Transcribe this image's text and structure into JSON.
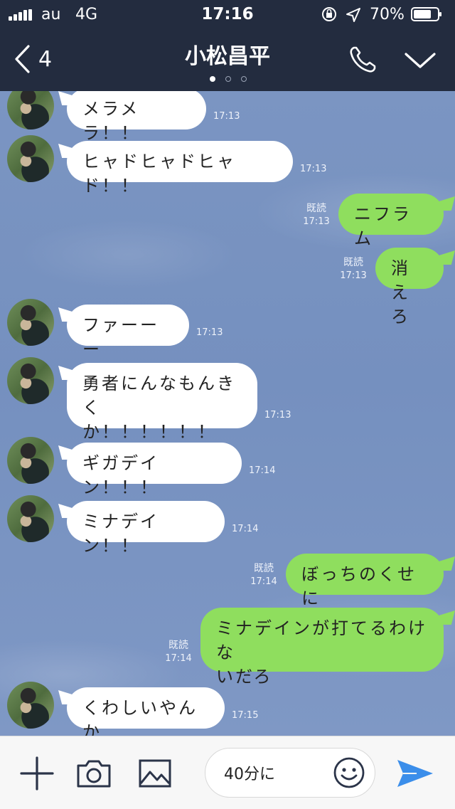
{
  "status_bar": {
    "carrier": "au",
    "network": "4G",
    "time": "17:16",
    "battery_percent": "70%",
    "icons": [
      "signal-icon",
      "orientation-lock-icon",
      "location-icon",
      "battery-icon"
    ]
  },
  "header": {
    "back_count": "4",
    "title": "小松昌平",
    "page_dots": 3,
    "active_dot": 0,
    "icons": [
      "back-chevron-icon",
      "phone-icon",
      "chevron-down-icon"
    ]
  },
  "messages": [
    {
      "side": "in",
      "text": "メラメラ！！",
      "time": "17:13"
    },
    {
      "side": "in",
      "text": "ヒャドヒャドヒャド！！",
      "time": "17:13"
    },
    {
      "side": "out",
      "text": "ニフラム",
      "read": "既読",
      "time": "17:13"
    },
    {
      "side": "out",
      "text": "消えろ",
      "read": "既読",
      "time": "17:13"
    },
    {
      "side": "in",
      "text": "ファーーー",
      "time": "17:13"
    },
    {
      "side": "in",
      "text": "勇者にんなもんきく\nか！！！！！！",
      "time": "17:13"
    },
    {
      "side": "in",
      "text": "ギガデイン！！！",
      "time": "17:14"
    },
    {
      "side": "in",
      "text": "ミナデイン！！",
      "time": "17:14"
    },
    {
      "side": "out",
      "text": "ぼっちのくせに",
      "read": "既読",
      "time": "17:14"
    },
    {
      "side": "out",
      "text": "ミナデインが打てるわけな\nいだろ",
      "read": "既読",
      "time": "17:14"
    },
    {
      "side": "in",
      "text": "くわしいやんか",
      "time": "17:15"
    }
  ],
  "input_bar": {
    "value": "40分に",
    "icons": [
      "plus-icon",
      "camera-icon",
      "image-icon",
      "emoji-icon",
      "send-icon"
    ]
  },
  "colors": {
    "header_bg": "#232c3f",
    "chat_bg": "#7791c0",
    "incoming_bubble": "#ffffff",
    "outgoing_bubble": "#8fde5e",
    "send_accent": "#3b8eea"
  }
}
